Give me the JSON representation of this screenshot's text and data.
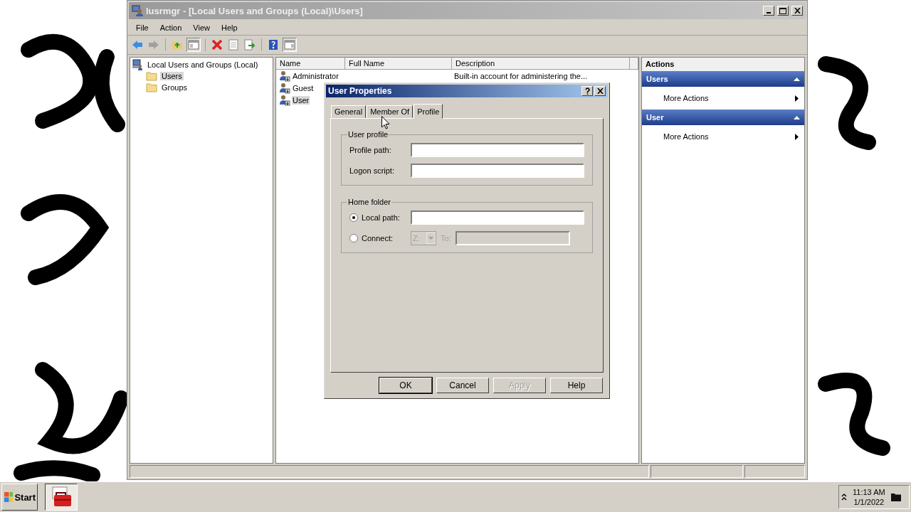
{
  "window": {
    "title": "lusrmgr - [Local Users and Groups (Local)\\Users]"
  },
  "menu": [
    "File",
    "Action",
    "View",
    "Help"
  ],
  "tree": [
    {
      "label": "Local Users and Groups (Local)",
      "selected": false,
      "children": [
        {
          "label": "Users",
          "selected": true
        },
        {
          "label": "Groups",
          "selected": false
        }
      ]
    }
  ],
  "list": {
    "columns": [
      "Name",
      "Full Name",
      "Description"
    ],
    "rows": [
      {
        "name": "Administrator",
        "description": "Built-in account for administering the...",
        "selected": false
      },
      {
        "name": "Guest",
        "selected": false
      },
      {
        "name": "User",
        "selected": true
      }
    ]
  },
  "actions": {
    "title": "Actions",
    "sections": [
      {
        "title": "Users",
        "items": [
          "More Actions"
        ]
      },
      {
        "title": "User",
        "items": [
          "More Actions"
        ]
      }
    ]
  },
  "dialog": {
    "title": "User Properties",
    "tabs": [
      {
        "label": "General",
        "selected": false
      },
      {
        "label": "Member Of",
        "selected": false
      },
      {
        "label": "Profile",
        "selected": true
      }
    ],
    "user_profile": {
      "legend": "User profile",
      "fields": [
        {
          "label": "Profile path:"
        },
        {
          "label": "Logon script:"
        }
      ]
    },
    "home_folder": {
      "legend": "Home folder",
      "options": [
        {
          "label": "Local path:",
          "selected": true
        },
        {
          "label": "Connect:",
          "selected": false
        }
      ],
      "drive": {
        "value": "Z:",
        "disabled": true
      },
      "to": {
        "label": "To:",
        "disabled": true
      }
    },
    "buttons": [
      {
        "label": "OK",
        "default": true,
        "disabled": false
      },
      {
        "label": "Cancel",
        "default": false,
        "disabled": false
      },
      {
        "label": "Apply",
        "default": false,
        "disabled": true
      },
      {
        "label": "Help",
        "default": false,
        "disabled": false
      }
    ]
  },
  "taskbar": {
    "start": "Start",
    "tasks": [
      {
        "selected": true
      }
    ],
    "time": "11:13 AM",
    "date": "1/1/2022"
  }
}
